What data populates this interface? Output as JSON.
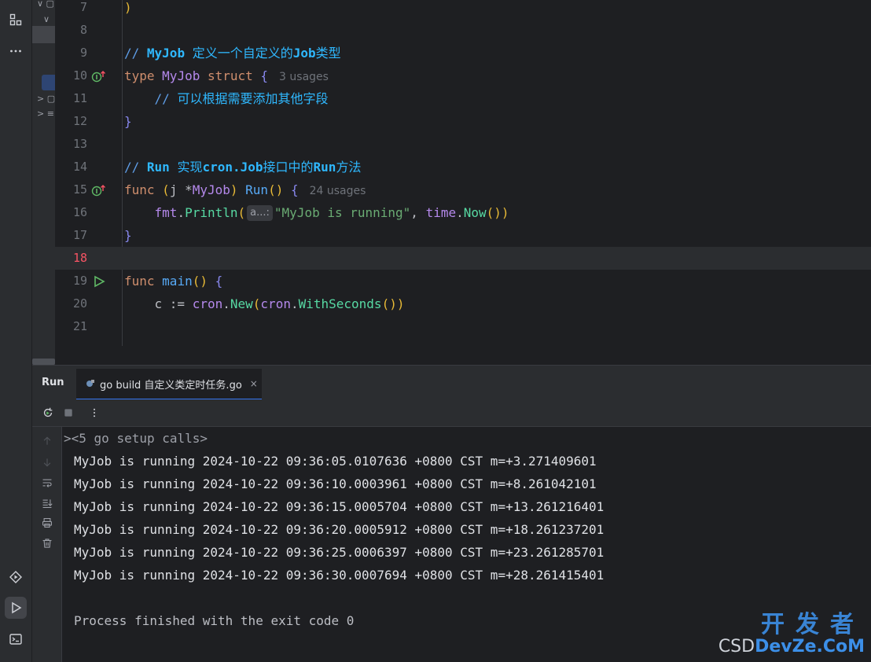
{
  "tree": {
    "rows": [
      "∨ ▢",
      "∨",
      "",
      "",
      "> ▢",
      "> ≡"
    ]
  },
  "editor": {
    "lines": [
      {
        "n": "7",
        "segments": [
          {
            "c": "par",
            "t": ")"
          }
        ]
      },
      {
        "n": "8",
        "segments": []
      },
      {
        "n": "9",
        "segments": [
          {
            "c": "cm",
            "t": "// "
          },
          {
            "c": "cmb",
            "t": "MyJob"
          },
          {
            "c": "cmg",
            "t": " 定义一个自定义的"
          },
          {
            "c": "cmb",
            "t": "Job"
          },
          {
            "c": "cmg",
            "t": "类型"
          }
        ]
      },
      {
        "n": "10",
        "icon": "implemented",
        "segments": [
          {
            "c": "kw",
            "t": "type "
          },
          {
            "c": "typ",
            "t": "MyJob "
          },
          {
            "c": "kw",
            "t": "struct "
          },
          {
            "c": "brace",
            "t": "{"
          }
        ],
        "hint": "3 usages"
      },
      {
        "n": "11",
        "segments": [
          {
            "c": "cm",
            "t": "    // "
          },
          {
            "c": "cmg",
            "t": "可以根据需要添加其他字段"
          }
        ]
      },
      {
        "n": "12",
        "segments": [
          {
            "c": "brace",
            "t": "}"
          }
        ]
      },
      {
        "n": "13",
        "segments": []
      },
      {
        "n": "14",
        "segments": [
          {
            "c": "cm",
            "t": "// "
          },
          {
            "c": "cmb",
            "t": "Run"
          },
          {
            "c": "cmg",
            "t": " 实现"
          },
          {
            "c": "cmb",
            "t": "cron.Job"
          },
          {
            "c": "cmg",
            "t": "接口中的"
          },
          {
            "c": "cmb",
            "t": "Run"
          },
          {
            "c": "cmg",
            "t": "方法"
          }
        ]
      },
      {
        "n": "15",
        "icon": "implemented",
        "segments": [
          {
            "c": "kw",
            "t": "func "
          },
          {
            "c": "par",
            "t": "("
          },
          {
            "c": "pun",
            "t": "j *"
          },
          {
            "c": "typ",
            "t": "MyJob"
          },
          {
            "c": "par",
            "t": ") "
          },
          {
            "c": "fng",
            "t": "Run"
          },
          {
            "c": "par",
            "t": "() "
          },
          {
            "c": "brace",
            "t": "{"
          }
        ],
        "hint": "24 usages"
      },
      {
        "n": "16",
        "segments": [
          {
            "c": "pun",
            "t": "    "
          },
          {
            "c": "pkg",
            "t": "fmt"
          },
          {
            "c": "pun",
            "t": "."
          },
          {
            "c": "meth",
            "t": "Println"
          },
          {
            "c": "par",
            "t": "("
          },
          {
            "c": "inlay",
            "t": "a...:"
          },
          {
            "c": "str",
            "t": "\"MyJob is running\""
          },
          {
            "c": "pun",
            "t": ", "
          },
          {
            "c": "pkg",
            "t": "time"
          },
          {
            "c": "pun",
            "t": "."
          },
          {
            "c": "meth",
            "t": "Now"
          },
          {
            "c": "par",
            "t": "())"
          }
        ]
      },
      {
        "n": "17",
        "segments": [
          {
            "c": "brace",
            "t": "}"
          }
        ]
      },
      {
        "n": "18",
        "current": true,
        "segments": []
      },
      {
        "n": "19",
        "icon": "run",
        "segments": [
          {
            "c": "kw",
            "t": "func "
          },
          {
            "c": "fng",
            "t": "main"
          },
          {
            "c": "par",
            "t": "() "
          },
          {
            "c": "brace",
            "t": "{"
          }
        ]
      },
      {
        "n": "20",
        "segments": [
          {
            "c": "pun",
            "t": "    c := "
          },
          {
            "c": "pkg",
            "t": "cron"
          },
          {
            "c": "pun",
            "t": "."
          },
          {
            "c": "meth",
            "t": "New"
          },
          {
            "c": "par",
            "t": "("
          },
          {
            "c": "pkg",
            "t": "cron"
          },
          {
            "c": "pun",
            "t": "."
          },
          {
            "c": "meth",
            "t": "WithSeconds"
          },
          {
            "c": "par",
            "t": "())"
          }
        ]
      },
      {
        "n": "21",
        "segments": []
      }
    ]
  },
  "run_panel": {
    "title": "Run",
    "tab_label": "go build 自定义类定时任务.go",
    "tab_close": "×"
  },
  "console": {
    "fold": "<5 go setup calls>",
    "lines": [
      "MyJob is running 2024-10-22 09:36:05.0107636 +0800 CST m=+3.271409601",
      "MyJob is running 2024-10-22 09:36:10.0003961 +0800 CST m=+8.261042101",
      "MyJob is running 2024-10-22 09:36:15.0005704 +0800 CST m=+13.261216401",
      "MyJob is running 2024-10-22 09:36:20.0005912 +0800 CST m=+18.261237201",
      "MyJob is running 2024-10-22 09:36:25.0006397 +0800 CST m=+23.261285701",
      "MyJob is running 2024-10-22 09:36:30.0007694 +0800 CST m=+28.261415401"
    ],
    "process": "Process finished with the exit code 0"
  },
  "watermark": {
    "top": "开发者",
    "csd": "CSD",
    "devze": "DevZe.CoM"
  }
}
